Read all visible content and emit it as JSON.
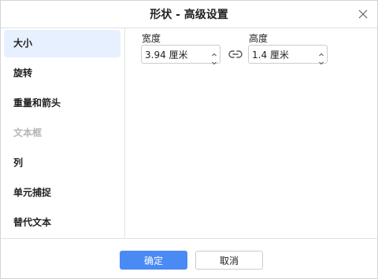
{
  "dialog": {
    "title": "形状 - 高级设置"
  },
  "sidebar": {
    "items": [
      {
        "label": "大小",
        "active": true,
        "disabled": false
      },
      {
        "label": "旋转",
        "active": false,
        "disabled": false
      },
      {
        "label": "重量和箭头",
        "active": false,
        "disabled": false
      },
      {
        "label": "文本框",
        "active": false,
        "disabled": true
      },
      {
        "label": "列",
        "active": false,
        "disabled": false
      },
      {
        "label": "单元捕捉",
        "active": false,
        "disabled": false
      },
      {
        "label": "替代文本",
        "active": false,
        "disabled": false
      }
    ]
  },
  "size": {
    "width_label": "宽度",
    "width_value": "3.94 厘米",
    "height_label": "高度",
    "height_value": "1.4 厘米"
  },
  "footer": {
    "ok_label": "确定",
    "cancel_label": "取消"
  },
  "colors": {
    "accent": "#4a8af4",
    "active_item_bg": "#e6f0ff",
    "disabled_text": "#b5b5b5"
  },
  "icons": {
    "close": "close-icon",
    "link": "link-icon",
    "spin_up": "chevron-up-icon",
    "spin_down": "chevron-down-icon"
  }
}
